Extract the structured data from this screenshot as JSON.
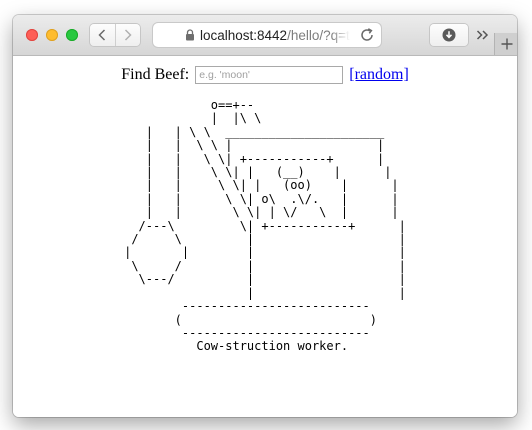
{
  "browser": {
    "url_host": "localhost:8442",
    "url_rest": "/hello/?q=t",
    "icons": {
      "back": "chevron-left-icon",
      "forward": "chevron-right-icon",
      "lock": "lock-icon",
      "reload": "reload-icon",
      "downloads": "download-icon",
      "overflow": "double-chevron-right-icon",
      "new_tab": "plus-icon"
    }
  },
  "search": {
    "label": "Find Beef:",
    "placeholder": "e.g. 'moon'",
    "value": "",
    "random_link": "[random]"
  },
  "cow_art": "            o==+--\n            |  |\\ \\\n   |   | \\ \\  ______________________\n   |   |  \\ \\ |                    |\n   |   |   \\ \\| +-----------+      |\n   |   |    \\ \\| |   (__)    |      |\n   |   |     \\ \\| |   (oo)    |      |\n   |   |      \\ \\| o\\  .\\/.   |      |\n   |   |       \\ \\| | \\/   \\  |      |\n  /---\\         \\| +-----------+      |\n /     \\         |                    |\n|       |        |                    |\n \\     /         |                    |\n  \\---/          |                    |\n                 |                    |\n        --------------------------\n       (                          )\n        --------------------------\n          Cow-struction worker."
}
